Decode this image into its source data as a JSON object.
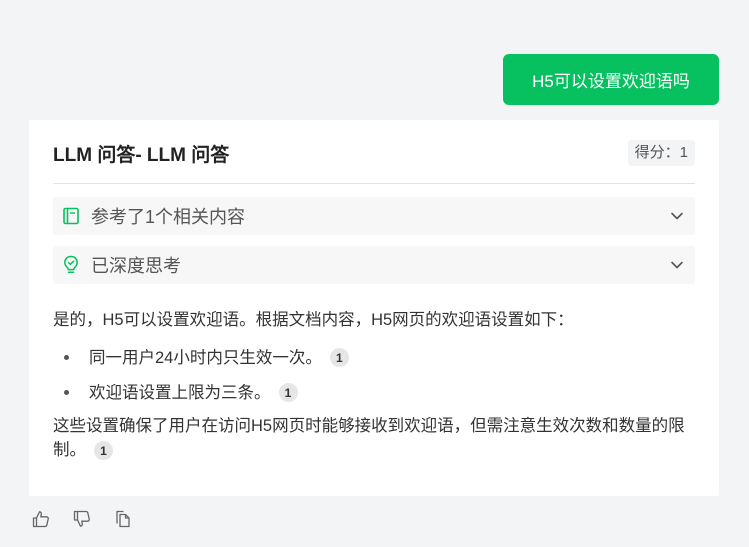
{
  "user_message": "H5可以设置欢迎语吗",
  "answer": {
    "title": "LLM 问答- LLM 问答",
    "score_label": "得分：",
    "score_value": "1",
    "references_label": "参考了1个相关内容",
    "thinking_label": "已深度思考",
    "intro": "是的，H5可以设置欢迎语。根据文档内容，H5网页的欢迎语设置如下：",
    "points": [
      {
        "text": "同一用户24小时内只生效一次。",
        "cite": "1"
      },
      {
        "text": "欢迎语设置上限为三条。",
        "cite": "1"
      }
    ],
    "conclusion": "这些设置确保了用户在访问H5网页时能够接收到欢迎语，但需注意生效次数和数量的限制。",
    "conclusion_cite": "1"
  },
  "colors": {
    "accent": "#07c160",
    "card_bg": "#ffffff",
    "page_bg": "#f3f4f6"
  },
  "icons": {
    "references": "book-icon",
    "thinking": "lightbulb-icon",
    "expand": "chevron-down-icon",
    "like": "thumbs-up-icon",
    "dislike": "thumbs-down-icon",
    "copy": "copy-icon"
  }
}
